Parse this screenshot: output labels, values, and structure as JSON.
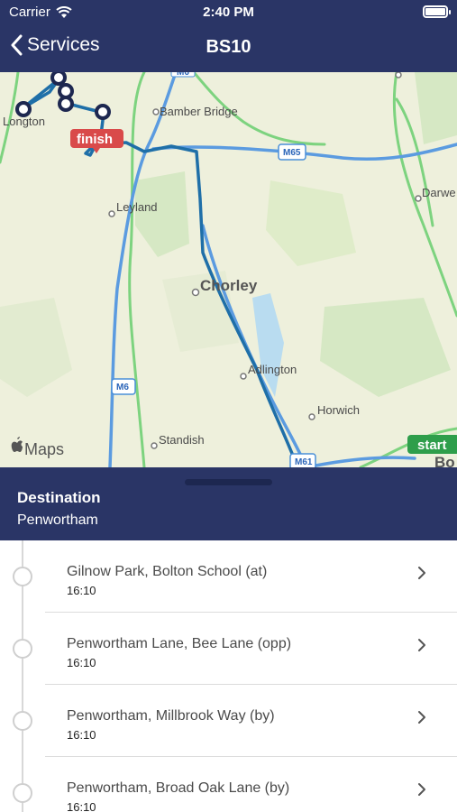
{
  "status_bar": {
    "carrier": "Carrier",
    "time": "2:40 PM"
  },
  "nav": {
    "back_label": "Services",
    "title": "BS10"
  },
  "map": {
    "places": {
      "longton": "Longton",
      "bamber_bridge": "Bamber Bridge",
      "leyland": "Leyland",
      "chorley": "Chorley",
      "adlington": "Adlington",
      "horwich": "Horwich",
      "standish": "Standish",
      "darwen": "Darwe",
      "bolton": "Bo"
    },
    "road_badges": {
      "m6_top": "M6",
      "m65": "M65",
      "m6": "M6",
      "m61": "M61"
    },
    "finish_label": "finish",
    "start_label": "start",
    "attribution": "Maps",
    "colors": {
      "land": "#eef0dc",
      "route": "#1f6fa8",
      "motorway": "#5b9be0",
      "a_road": "#7dd37f",
      "finish": "#d94a4a",
      "start": "#2e9e4b",
      "stop_marker": "#1d2750"
    }
  },
  "destination": {
    "label": "Destination",
    "value": "Penwortham"
  },
  "stops": [
    {
      "name": "Gilnow Park, Bolton School (at)",
      "time": "16:10"
    },
    {
      "name": "Penwortham Lane, Bee Lane (opp)",
      "time": "16:10"
    },
    {
      "name": "Penwortham, Millbrook Way (by)",
      "time": "16:10"
    },
    {
      "name": "Penwortham, Broad Oak Lane (by)",
      "time": "16:10"
    }
  ]
}
